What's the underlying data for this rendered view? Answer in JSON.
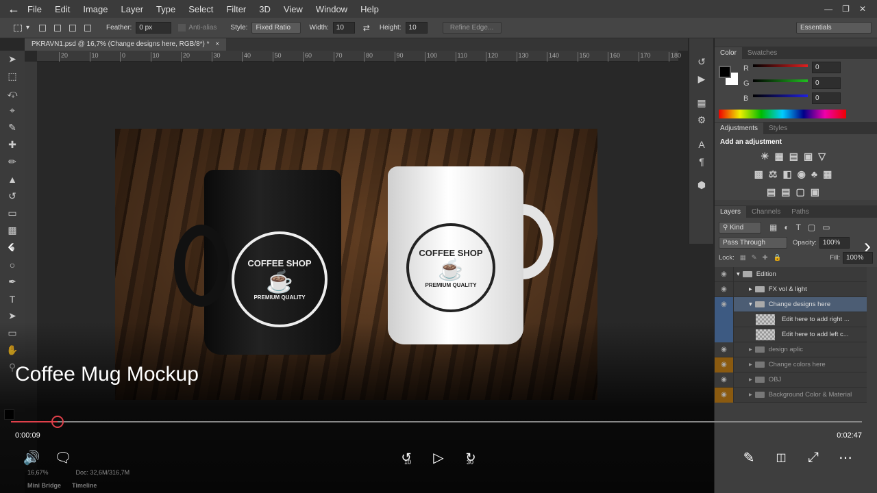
{
  "menu": [
    "File",
    "Edit",
    "Image",
    "Layer",
    "Type",
    "Select",
    "Filter",
    "3D",
    "View",
    "Window",
    "Help"
  ],
  "options": {
    "feather_label": "Feather:",
    "feather": "0 px",
    "antialias": "Anti-alias",
    "style_label": "Style:",
    "style": "Fixed Ratio",
    "width_label": "Width:",
    "width": "10",
    "height_label": "Height:",
    "height": "10",
    "refine": "Refine Edge...",
    "workspace": "Essentials"
  },
  "document_tab": "PKRAVN1.psd @ 16,7% (Change designs here, RGB/8*) *",
  "ruler": [
    "20",
    "10",
    "0",
    "10",
    "20",
    "30",
    "40",
    "50",
    "60",
    "70",
    "80",
    "90",
    "100",
    "110",
    "120",
    "130",
    "140",
    "150",
    "160",
    "170",
    "180"
  ],
  "mug": {
    "title": "COFFEE SHOP",
    "subtitle": "PREMIUM QUALITY"
  },
  "color_panel": {
    "tabs": [
      "Color",
      "Swatches"
    ],
    "r": "0",
    "g": "0",
    "b": "0",
    "r_label": "R",
    "g_label": "G",
    "b_label": "B"
  },
  "adjustments": {
    "tabs": [
      "Adjustments",
      "Styles"
    ],
    "heading": "Add an adjustment"
  },
  "layers": {
    "tabs": [
      "Layers",
      "Channels",
      "Paths"
    ],
    "kind": "Kind",
    "blend": "Pass Through",
    "opacity_label": "Opacity:",
    "opacity": "100%",
    "lock_label": "Lock:",
    "fill_label": "Fill:",
    "fill": "100%",
    "items": [
      {
        "name": "Edition"
      },
      {
        "name": "FX vol & light"
      },
      {
        "name": "Change designs here"
      },
      {
        "name": "Edit here to add  right ..."
      },
      {
        "name": "Edit here to add  left c..."
      },
      {
        "name": "design aplic"
      },
      {
        "name": "Change colors here"
      },
      {
        "name": "OBJ"
      },
      {
        "name": "Background Color & Material"
      }
    ]
  },
  "status": {
    "zoom": "16,67%",
    "doc": "Doc: 32,6M/316,7M",
    "tabs": [
      "Mini Bridge",
      "Timeline"
    ]
  },
  "video": {
    "title": "Coffee Mug Mockup",
    "elapsed": "0:00:09",
    "duration": "0:02:47",
    "progress": 0.055,
    "rewind": "10",
    "forward": "30"
  }
}
